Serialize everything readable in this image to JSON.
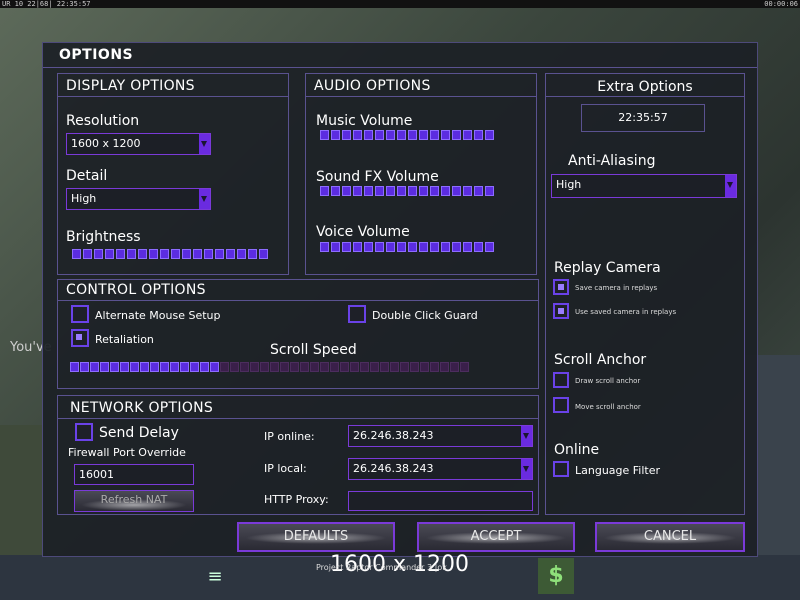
{
  "topbar": {
    "left": "UR 10 22|68| 22:35:57",
    "right": "00:00:06"
  },
  "background": {
    "left_text": "You've",
    "footer_text": "Project Raptor Commander 3 |ok",
    "big_resolution": "1600 x 1200"
  },
  "icons": {
    "money": "$",
    "list": "≡"
  },
  "dialog": {
    "title": "OPTIONS"
  },
  "display": {
    "title": "DISPLAY OPTIONS",
    "resolution_label": "Resolution",
    "resolution_value": "1600 x 1200",
    "detail_label": "Detail",
    "detail_value": "High",
    "brightness_label": "Brightness",
    "brightness_level": 1.0,
    "brightness_segments": 18
  },
  "audio": {
    "title": "AUDIO OPTIONS",
    "music_label": "Music Volume",
    "music_level": 1.0,
    "sfx_label": "Sound FX Volume",
    "sfx_level": 1.0,
    "voice_label": "Voice Volume",
    "voice_level": 1.0,
    "segments": 16
  },
  "extra": {
    "title": "Extra Options",
    "clock": "22:35:57",
    "aa_label": "Anti-Aliasing",
    "aa_value": "High",
    "replay_label": "Replay Camera",
    "save_camera_label": "Save camera in replays",
    "save_camera": true,
    "use_camera_label": "Use saved camera in replays",
    "use_camera": true,
    "scroll_anchor_label": "Scroll Anchor",
    "draw_anchor_label": "Draw scroll anchor",
    "draw_anchor": false,
    "move_anchor_label": "Move scroll anchor",
    "move_anchor": false,
    "online_label": "Online",
    "language_filter_label": "Language Filter",
    "language_filter": false
  },
  "control": {
    "title": "CONTROL OPTIONS",
    "alt_mouse_label": "Alternate Mouse Setup",
    "alt_mouse": false,
    "double_click_label": "Double Click Guard",
    "double_click": false,
    "retaliation_label": "Retaliation",
    "retaliation": true,
    "scroll_speed_label": "Scroll Speed",
    "scroll_speed_level": 0.375,
    "scroll_segments": 40
  },
  "network": {
    "title": "NETWORK OPTIONS",
    "send_delay_label": "Send Delay",
    "send_delay": false,
    "firewall_label": "Firewall Port Override",
    "firewall_value": "16001",
    "refresh_nat_label": "Refresh NAT",
    "ip_online_label": "IP online:",
    "ip_online_value": "26.246.38.243",
    "ip_local_label": "IP local:",
    "ip_local_value": "26.246.38.243",
    "http_proxy_label": "HTTP Proxy:",
    "http_proxy_value": ""
  },
  "buttons": {
    "defaults": "DEFAULTS",
    "accept": "ACCEPT",
    "cancel": "CANCEL"
  },
  "colors": {
    "accent": "#7a3ad8",
    "segment_on": "#5b2ce0",
    "segment_off": "#3a1f4a",
    "border": "#5a5290"
  }
}
